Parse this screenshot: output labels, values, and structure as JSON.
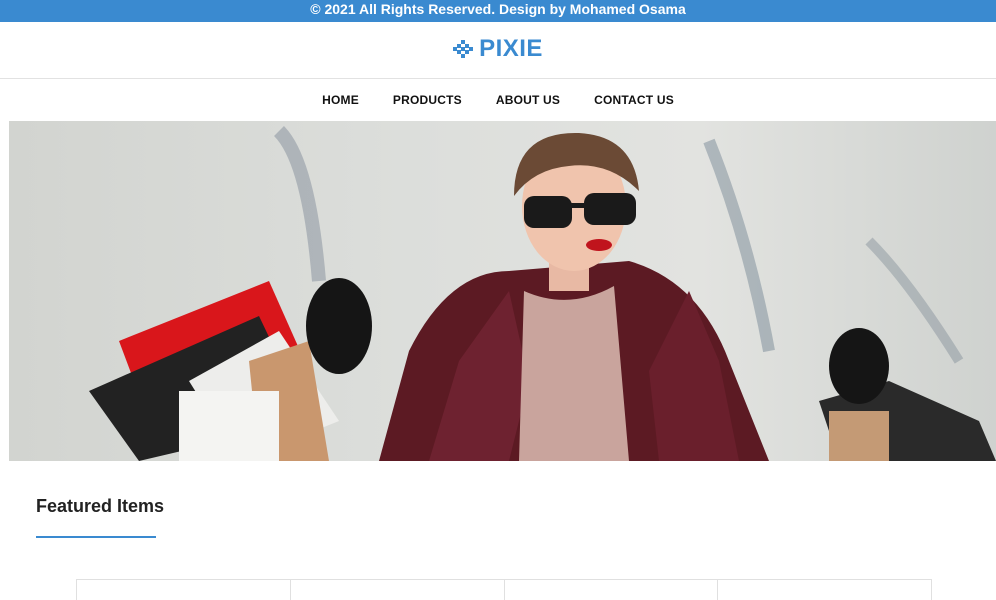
{
  "topbar": {
    "text": "© 2021 All Rights Reserved. Design by Mohamed Osama"
  },
  "brand": {
    "name": "PIXIE",
    "icon": "pixel-grid-icon"
  },
  "nav": {
    "items": [
      {
        "label": "HOME"
      },
      {
        "label": "PRODUCTS"
      },
      {
        "label": "ABOUT US"
      },
      {
        "label": "CONTACT US"
      }
    ]
  },
  "hero": {
    "image": "woman-with-shopping-bags-photo"
  },
  "featured": {
    "title": "Featured Items"
  },
  "colors": {
    "accent": "#3a8ad0",
    "text": "#222222"
  }
}
